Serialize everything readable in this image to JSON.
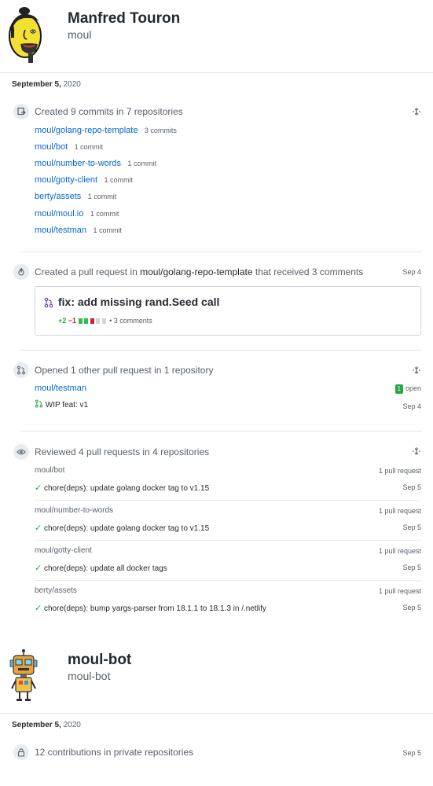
{
  "user1": {
    "name": "Manfred Touron",
    "login": "moul",
    "date": "September 5,",
    "year": "2020",
    "commits": {
      "title": "Created 9 commits in 7 repositories",
      "repos": [
        {
          "name": "moul/golang-repo-template",
          "count": "3 commits"
        },
        {
          "name": "moul/bot",
          "count": "1 commit"
        },
        {
          "name": "moul/number-to-words",
          "count": "1 commit"
        },
        {
          "name": "moul/gotty-client",
          "count": "1 commit"
        },
        {
          "name": "berty/assets",
          "count": "1 commit"
        },
        {
          "name": "moul/moul.io",
          "count": "1 commit"
        },
        {
          "name": "moul/testman",
          "count": "1 commit"
        }
      ]
    },
    "pull_request": {
      "title_pre": "Created a pull request in",
      "repo": "moul/golang-repo-template",
      "title_post": "that received 3 comments",
      "date": "Sep 4",
      "card_title": "fix: add missing rand.Seed call",
      "additions": "+2",
      "deletions": "−1",
      "comments": "• 3 comments"
    },
    "opened": {
      "title": "Opened 1 other pull request in 1 repository",
      "repo": "moul/testman",
      "open_count": "1",
      "open_label": "open",
      "pr_title": "WIP feat: v1",
      "date": "Sep 4"
    },
    "reviewed": {
      "title": "Reviewed 4 pull requests in 4 repositories",
      "items": [
        {
          "repo": "moul/bot",
          "count": "1 pull request",
          "title": "chore(deps): update golang docker tag to v1.15",
          "date": "Sep 5"
        },
        {
          "repo": "moul/number-to-words",
          "count": "1 pull request",
          "title": "chore(deps): update golang docker tag to v1.15",
          "date": "Sep 5"
        },
        {
          "repo": "moul/gotty-client",
          "count": "1 pull request",
          "title": "chore(deps): update all docker tags",
          "date": "Sep 5"
        },
        {
          "repo": "berty/assets",
          "count": "1 pull request",
          "title": "chore(deps): bump yargs-parser from 18.1.1 to 18.1.3 in /.netlify",
          "date": "Sep 5"
        }
      ]
    }
  },
  "user2": {
    "name": "moul-bot",
    "login": "moul-bot",
    "date": "September 5,",
    "year": "2020",
    "private": {
      "title": "12 contributions in private repositories",
      "date": "Sep 5"
    }
  },
  "colors": {
    "link": "#0366d6",
    "green": "#28a745",
    "red": "#cb2431",
    "pr_icon": "#6f42c1"
  }
}
